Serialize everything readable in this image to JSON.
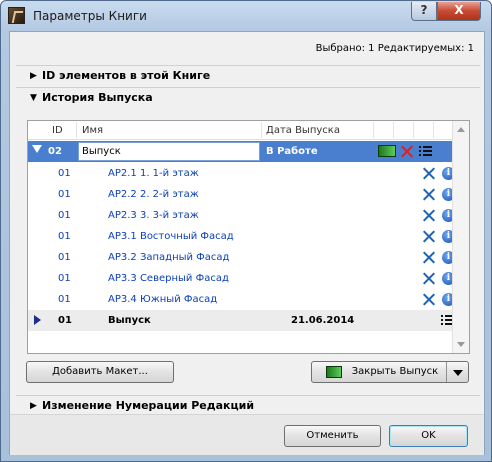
{
  "window": {
    "title": "Параметры Книги",
    "help_label": "?",
    "close_label": "X"
  },
  "status": {
    "selected_text": "Выбрано: 1 Редактируемых: 1"
  },
  "sections": {
    "ids_label": "ID элементов в этой Книге",
    "history_label": "История Выпуска",
    "renumber_label": "Изменение Нумерации Редакций"
  },
  "grid": {
    "headers": {
      "id": "ID",
      "name": "Имя",
      "date": "Дата Выпуска"
    },
    "selected_row": {
      "id": "02",
      "name": "Выпуск",
      "date": "В Работе"
    },
    "rows": [
      {
        "id": "01",
        "name": "АР2.1 1. 1-й этаж"
      },
      {
        "id": "01",
        "name": "АР2.2 2. 2-й этаж"
      },
      {
        "id": "01",
        "name": "АР2.3 3. 3-й этаж"
      },
      {
        "id": "01",
        "name": "АР3.1 Восточный Фасад"
      },
      {
        "id": "01",
        "name": "АР3.2 Западный Фасад"
      },
      {
        "id": "01",
        "name": "АР3.3 Северный Фасад"
      },
      {
        "id": "01",
        "name": "АР3.4 Южный Фасад"
      }
    ],
    "issued_row": {
      "id": "01",
      "name": "Выпуск",
      "date": "21.06.2014"
    }
  },
  "buttons": {
    "add_layout": "Добавить Макет...",
    "close_issue": "Закрыть Выпуск",
    "cancel": "Отменить",
    "ok": "OK"
  },
  "colors": {
    "selection": "#4a7fd0",
    "link": "#0b3fb7",
    "delete": "#e02020"
  }
}
